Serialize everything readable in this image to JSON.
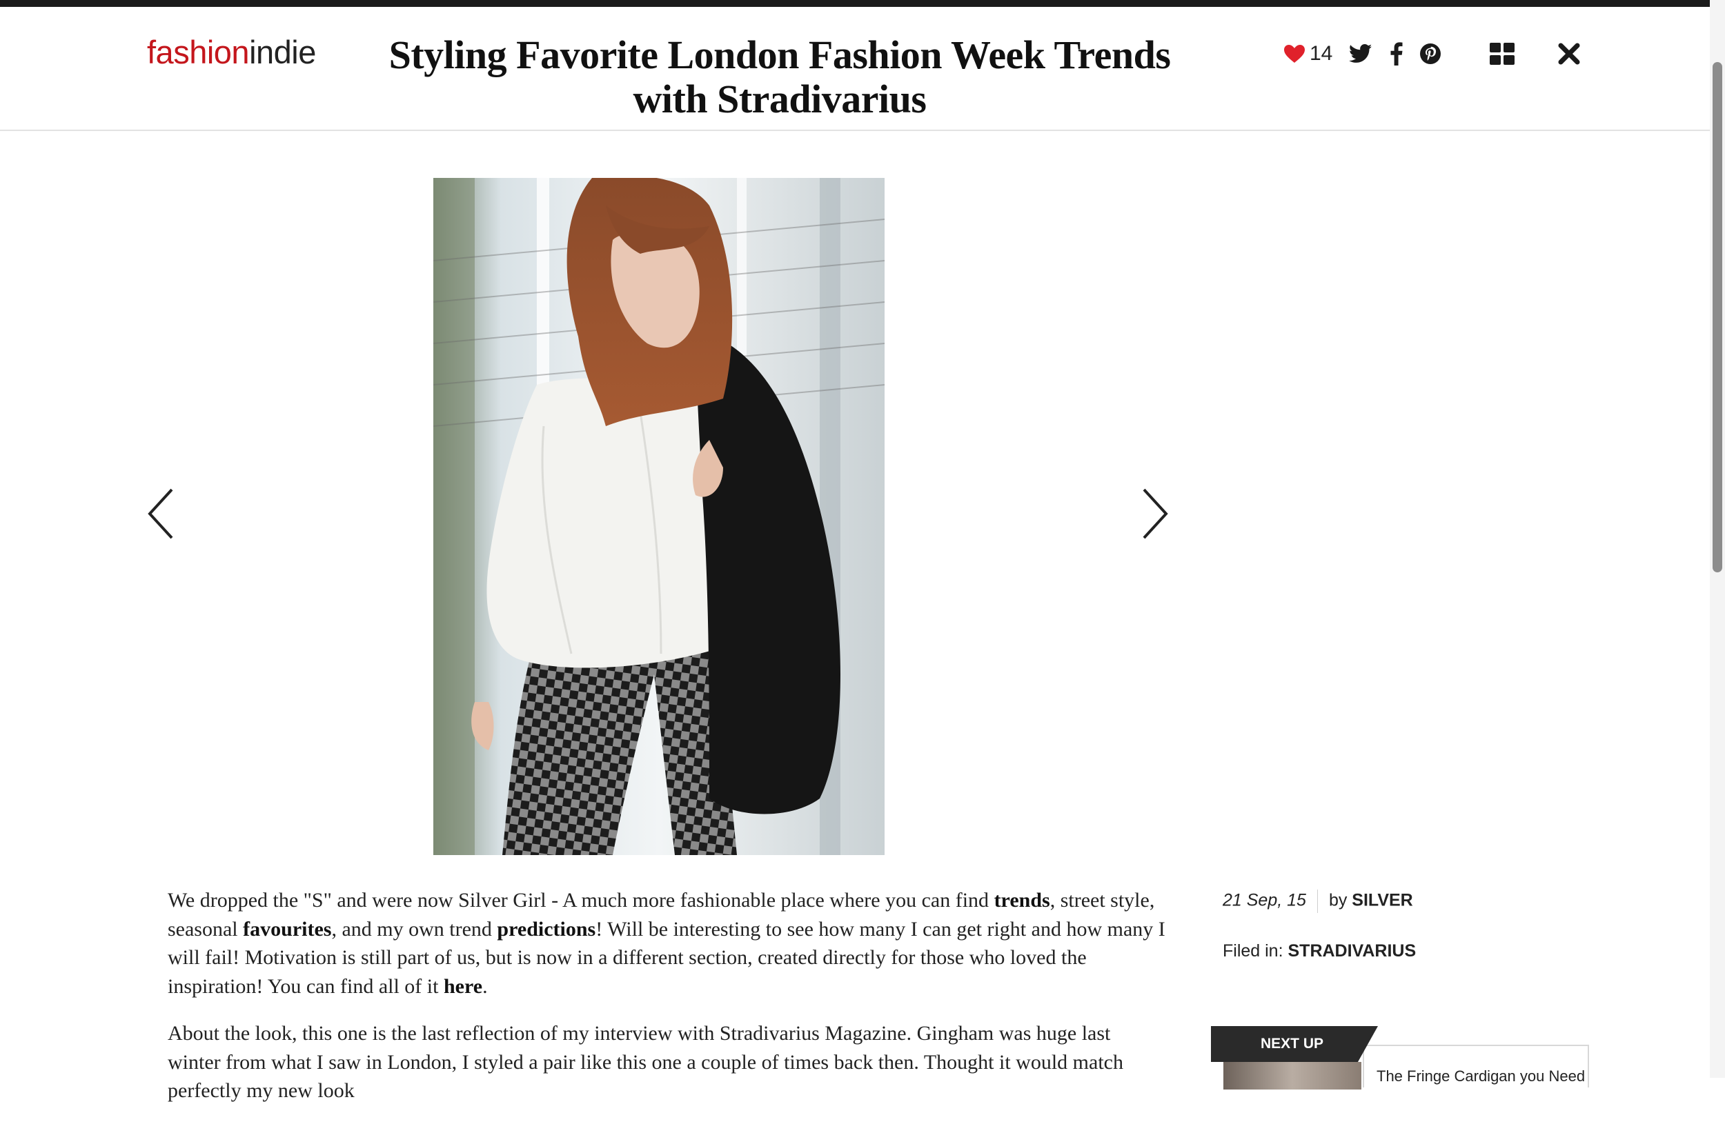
{
  "brand": {
    "part1": "fashion",
    "part2": "indie"
  },
  "article": {
    "title": "Styling Favorite London Fashion Week Trends with Stradivarius",
    "paragraph1": [
      {
        "t": "We dropped the \"S\" and were now Silver Girl - A much more fashionable place where you can find ",
        "b": false
      },
      {
        "t": "trends",
        "b": true
      },
      {
        "t": ", street style, seasonal ",
        "b": false
      },
      {
        "t": "favourites",
        "b": true
      },
      {
        "t": ", and my own trend ",
        "b": false
      },
      {
        "t": "predictions",
        "b": true
      },
      {
        "t": "! Will be interesting to see how many I can get right and how many I will fail! Motivation is still part of us, but is now in a different section, created directly for those who loved the inspiration! You can find all of it ",
        "b": false
      },
      {
        "t": "here",
        "b": true
      },
      {
        "t": ".",
        "b": false
      }
    ],
    "paragraph2": "About the look, this one is the last reflection of my interview with Stradivarius Magazine. Gingham was huge last winter from what I saw in London, I styled a pair like this one a couple of times back then. Thought it would match perfectly my new look"
  },
  "actions": {
    "like_count": "14",
    "icons": [
      "heart-icon",
      "twitter-icon",
      "facebook-icon",
      "pinterest-icon",
      "grid-icon",
      "close-icon"
    ]
  },
  "gallery": {
    "prev_icon": "chevron-left-icon",
    "next_icon": "chevron-right-icon"
  },
  "meta": {
    "date": "21 Sep, 15",
    "by_label": "by",
    "author": "SILVER",
    "filed_label": "Filed in:",
    "category": "STRADIVARIUS"
  },
  "next_up": {
    "label": "NEXT UP",
    "title": "The Fringe Cardigan you Need"
  },
  "colors": {
    "brand_red": "#c4161c",
    "like_red": "#e0212b",
    "topbar": "#1b1b1b"
  }
}
